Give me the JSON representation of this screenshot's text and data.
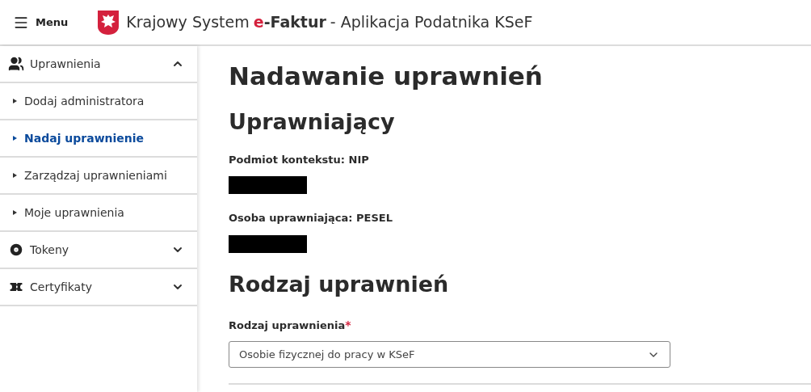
{
  "header": {
    "menu_label": "Menu",
    "title_prefix": "Krajowy System",
    "brand": "e-Faktur",
    "title_suffix": "- Aplikacja Podatnika KSeF"
  },
  "sidebar": {
    "sections": [
      {
        "label": "Uprawnienia",
        "kind": "people",
        "expanded": true,
        "children": [
          {
            "label": "Dodaj administratora",
            "selected": false
          },
          {
            "label": "Nadaj uprawnienie",
            "selected": true
          },
          {
            "label": "Zarządzaj uprawnieniami",
            "selected": false
          },
          {
            "label": "Moje uprawnienia",
            "selected": false
          }
        ]
      },
      {
        "label": "Tokeny",
        "kind": "token",
        "expanded": false
      },
      {
        "label": "Certyfikaty",
        "kind": "certificate",
        "expanded": false
      }
    ]
  },
  "main": {
    "title": "Nadawanie uprawnień",
    "section_1": {
      "title": "Uprawniający",
      "fields": [
        {
          "label": "Podmiot kontekstu: NIP",
          "redacted": true
        },
        {
          "label": "Osoba uprawniająca: PESEL",
          "redacted": true
        }
      ]
    },
    "section_2": {
      "title": "Rodzaj uprawnień",
      "select": {
        "label": "Rodzaj uprawnienia",
        "required": true,
        "required_mark": "*",
        "value": "Osobie fizycznej do pracy w KSeF"
      }
    }
  }
}
